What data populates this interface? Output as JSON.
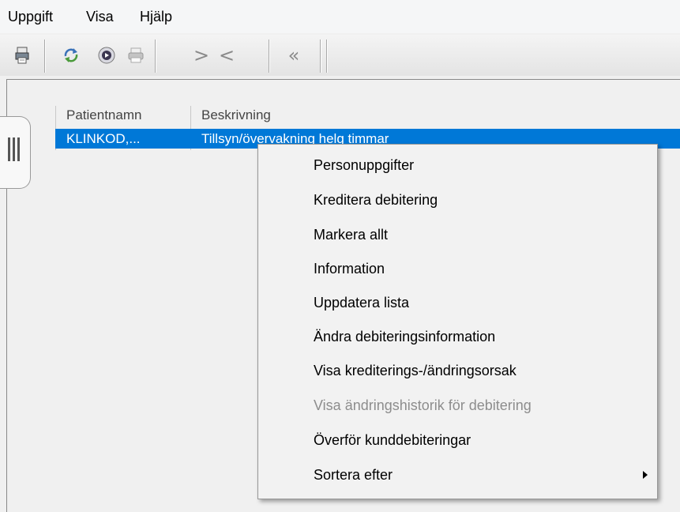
{
  "menubar": {
    "items": [
      "Uppgift",
      "Visa",
      "Hjälp"
    ]
  },
  "toolbar": {
    "buttons": [
      "print-list-icon",
      "refresh-icon",
      "navigate-icon",
      "printer-icon"
    ],
    "nav": {
      "next": ">",
      "prev": "<",
      "first": "«"
    }
  },
  "list": {
    "columns": [
      "Patientnamn",
      "Beskrivning"
    ],
    "rows": [
      {
        "patient": "KLINKOD,...",
        "description": "Tillsyn/övervakning helg timmar"
      }
    ]
  },
  "context_menu": {
    "items": [
      {
        "label": "Personuppgifter",
        "enabled": true
      },
      {
        "label": "Kreditera debitering",
        "enabled": true
      },
      {
        "label": "Markera allt",
        "enabled": true
      },
      {
        "label": "Information",
        "enabled": true
      },
      {
        "label": "Uppdatera lista",
        "enabled": true
      },
      {
        "label": "Ändra debiteringsinformation",
        "enabled": true
      },
      {
        "label": "Visa krediterings-/ändringsorsak",
        "enabled": true
      },
      {
        "label": "Visa ändringshistorik för debitering",
        "enabled": false
      },
      {
        "label": "Överför kunddebiteringar",
        "enabled": true
      },
      {
        "label": "Sortera efter",
        "enabled": true,
        "submenu": true
      }
    ]
  },
  "colors": {
    "selection": "#0078d7",
    "disabled_text": "#8d8d8d"
  }
}
